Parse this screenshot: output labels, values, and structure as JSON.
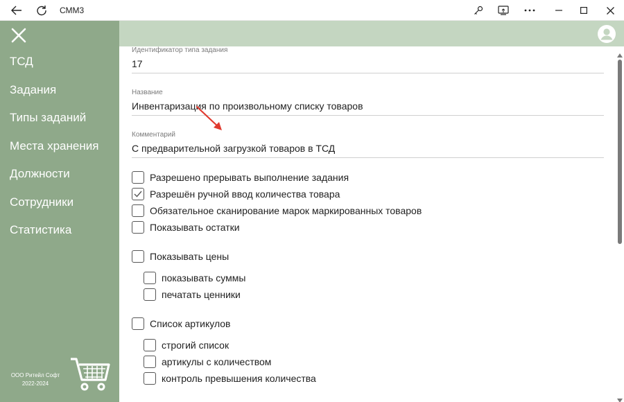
{
  "titlebar": {
    "title": "СММ3",
    "back_icon": "back-arrow-icon",
    "refresh_icon": "refresh-icon",
    "right_icons": [
      "key-icon",
      "cast-icon",
      "more-icon",
      "minimize-icon",
      "maximize-icon",
      "close-icon"
    ]
  },
  "sidebar": {
    "items": [
      {
        "label": "ТСД"
      },
      {
        "label": "Задания"
      },
      {
        "label": "Типы заданий"
      },
      {
        "label": "Места хранения"
      },
      {
        "label": "Должности"
      },
      {
        "label": "Сотрудники"
      },
      {
        "label": "Статистика"
      }
    ],
    "copyright_line1": "ООО Ритейл Софт",
    "copyright_line2": "2022-2024"
  },
  "form": {
    "id_label": "Идентификатор типа задания",
    "id_value": "17",
    "name_label": "Название",
    "name_value": "Инвентаризация по произвольному списку товаров",
    "comment_label": "Комментарий",
    "comment_value": "С предварительной загрузкой товаров в ТСД",
    "checkboxes": [
      {
        "label": "Разрешено прерывать выполнение задания",
        "checked": false
      },
      {
        "label": "Разрешён ручной ввод количества товара",
        "checked": true
      },
      {
        "label": "Обязательное сканирование марок маркированных товаров",
        "checked": false
      },
      {
        "label": "Показывать остатки",
        "checked": false
      },
      {
        "label": "Показывать цены",
        "checked": false
      },
      {
        "label": "показывать суммы",
        "checked": false
      },
      {
        "label": "печатать ценники",
        "checked": false
      },
      {
        "label": "Список артикулов",
        "checked": false
      },
      {
        "label": "строгий список",
        "checked": false
      },
      {
        "label": "артикулы с количеством",
        "checked": false
      },
      {
        "label": "контроль превышения количества",
        "checked": false
      }
    ]
  },
  "colors": {
    "sidebar": "#8fa98a",
    "topstrip": "#c4d6c1",
    "annotation_arrow": "#e03a2f"
  }
}
